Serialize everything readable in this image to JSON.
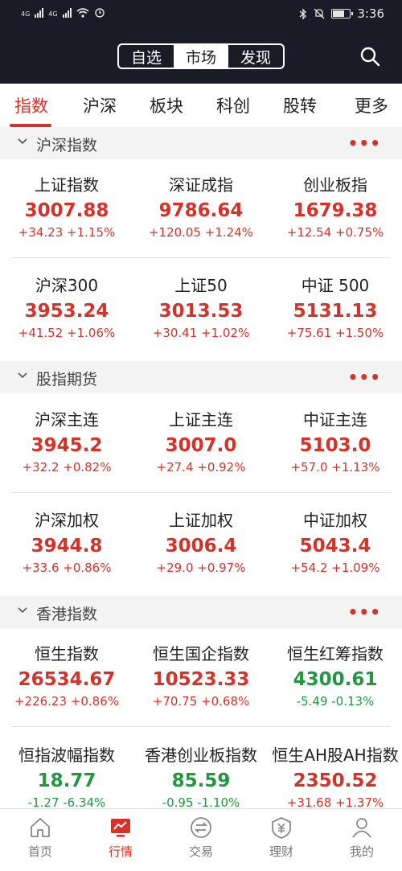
{
  "status": {
    "network_left": "4G",
    "network_right": "4G",
    "time": "3:36"
  },
  "header": {
    "segments": [
      "自选",
      "市场",
      "发现"
    ],
    "active_segment": 1
  },
  "tabs": [
    "指数",
    "沪深",
    "板块",
    "科创",
    "股转",
    "更多"
  ],
  "sections": {
    "hs": {
      "title": "沪深指数",
      "more": "•••"
    },
    "fut": {
      "title": "股指期货",
      "more": "•••"
    },
    "hk": {
      "title": "香港指数",
      "more": "•••"
    }
  },
  "quotes": {
    "hs": [
      {
        "name": "上证指数",
        "price": "3007.88",
        "change": "+34.23 +1.15%"
      },
      {
        "name": "深证成指",
        "price": "9786.64",
        "change": "+120.05 +1.24%"
      },
      {
        "name": "创业板指",
        "price": "1679.38",
        "change": "+12.54 +0.75%"
      },
      {
        "name": "沪深300",
        "price": "3953.24",
        "change": "+41.52 +1.06%"
      },
      {
        "name": "上证50",
        "price": "3013.53",
        "change": "+30.41 +1.02%"
      },
      {
        "name": "中证 500",
        "price": "5131.13",
        "change": "+75.61 +1.50%"
      }
    ],
    "fut": [
      {
        "name": "沪深主连",
        "price": "3945.2",
        "change": "+32.2 +0.82%"
      },
      {
        "name": "上证主连",
        "price": "3007.0",
        "change": "+27.4 +0.92%"
      },
      {
        "name": "中证主连",
        "price": "5103.0",
        "change": "+57.0 +1.13%"
      },
      {
        "name": "沪深加权",
        "price": "3944.8",
        "change": "+33.6 +0.86%"
      },
      {
        "name": "上证加权",
        "price": "3006.4",
        "change": "+29.0 +0.97%"
      },
      {
        "name": "中证加权",
        "price": "5043.4",
        "change": "+54.2 +1.09%"
      }
    ],
    "hk": [
      {
        "name": "恒生指数",
        "price": "26534.67",
        "change": "+226.23 +0.86%"
      },
      {
        "name": "恒生国企指数",
        "price": "10523.33",
        "change": "+70.75 +0.68%"
      },
      {
        "name": "恒生红筹指数",
        "price": "4300.61",
        "change": "-5.49 -0.13%"
      },
      {
        "name": "恒指波幅指数",
        "price": "18.77",
        "change": "-1.27 -6.34%"
      },
      {
        "name": "香港创业板指数",
        "price": "85.59",
        "change": "-0.95 -1.10%"
      },
      {
        "name": "恒生AH股AH指数",
        "price": "2350.52",
        "change": "+31.68 +1.37%"
      }
    ]
  },
  "colors": {
    "up": "#d5322a",
    "down": "#1e9a3d",
    "header_bg": "#191c26"
  },
  "bottom_nav": [
    {
      "label": "首页",
      "icon": "home-icon"
    },
    {
      "label": "行情",
      "icon": "market-chart-icon"
    },
    {
      "label": "交易",
      "icon": "trade-icon"
    },
    {
      "label": "理财",
      "icon": "wealth-icon"
    },
    {
      "label": "我的",
      "icon": "profile-icon"
    }
  ],
  "active_nav": 1
}
